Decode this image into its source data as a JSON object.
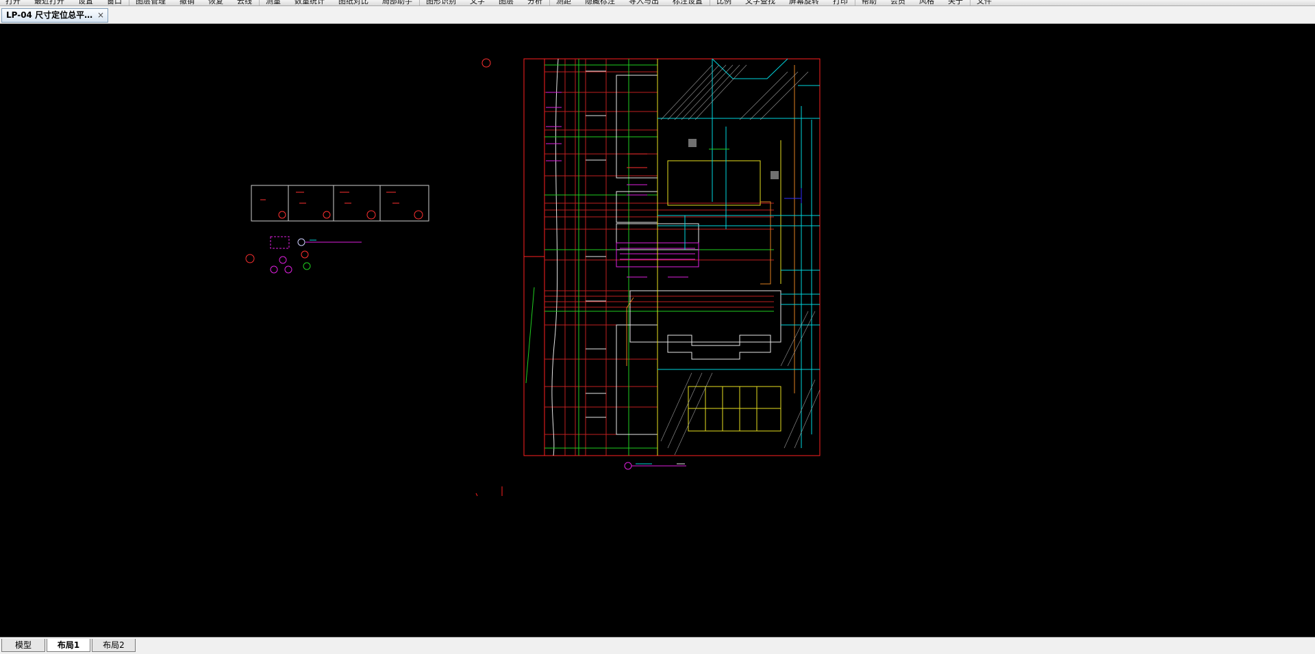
{
  "menu": {
    "items": [
      "打开",
      "最近打开",
      "设置",
      "窗口",
      "图层管理",
      "撤销",
      "恢复",
      "云线",
      "测量",
      "数量统计",
      "图纸对比",
      "局部助手",
      "图形识别",
      "文字",
      "图层",
      "分析",
      "测距",
      "隐藏标注",
      "导入与出",
      "标注设置",
      "比例",
      "文字查找",
      "屏幕旋转",
      "打印",
      "帮助",
      "会员",
      "风格",
      "关于",
      "文件"
    ]
  },
  "document_tab": {
    "title": "LP-04 尺寸定位总平…",
    "close": "×"
  },
  "layout_tabs": [
    "模型",
    "布局1",
    "布局2"
  ],
  "active_layout": "布局1",
  "colors": {
    "background": "#000000",
    "frame": "#ff2020",
    "cyan": "#00d8e0",
    "magenta": "#e020e0",
    "yellow": "#e8e020",
    "green": "#20d020",
    "white": "#e8e8e8",
    "orange": "#e08020"
  }
}
